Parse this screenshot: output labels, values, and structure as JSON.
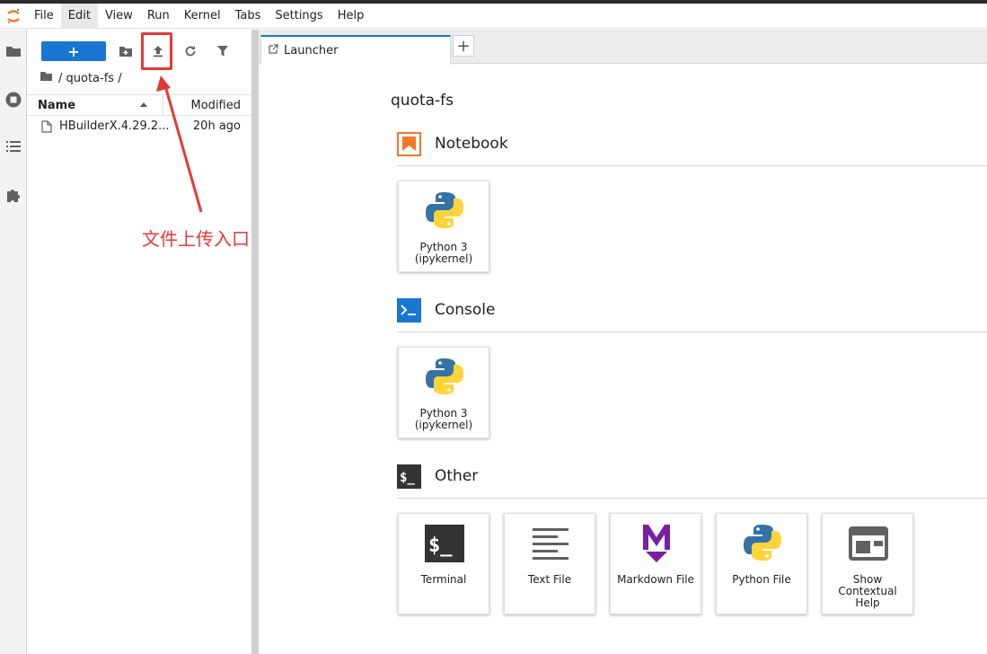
{
  "menu": [
    "File",
    "Edit",
    "View",
    "Run",
    "Kernel",
    "Tabs",
    "Settings",
    "Help"
  ],
  "filebrowser": {
    "new_label": "+",
    "path": "/ quota-fs /",
    "columns": {
      "name": "Name",
      "modified": "Modified"
    },
    "files": [
      {
        "name": "HBuilderX.4.29.2...",
        "modified": "20h ago"
      }
    ]
  },
  "tab": {
    "label": "Launcher",
    "add": "+"
  },
  "launcher": {
    "title": "quota-fs",
    "sections": {
      "notebook": {
        "title": "Notebook",
        "cards": [
          {
            "label": "Python 3 (ipykernel)"
          }
        ]
      },
      "console": {
        "title": "Console",
        "cards": [
          {
            "label": "Python 3 (ipykernel)"
          }
        ]
      },
      "other": {
        "title": "Other",
        "cards": [
          {
            "label": "Terminal"
          },
          {
            "label": "Text File"
          },
          {
            "label": "Markdown File"
          },
          {
            "label": "Python File"
          },
          {
            "label": "Show Contextual Help"
          }
        ]
      }
    }
  },
  "annotation": {
    "text": "文件上传入口"
  },
  "colors": {
    "accent": "#1976d2",
    "annotation": "#e53935",
    "notebook": "#f37726",
    "console": "#1976d2"
  }
}
